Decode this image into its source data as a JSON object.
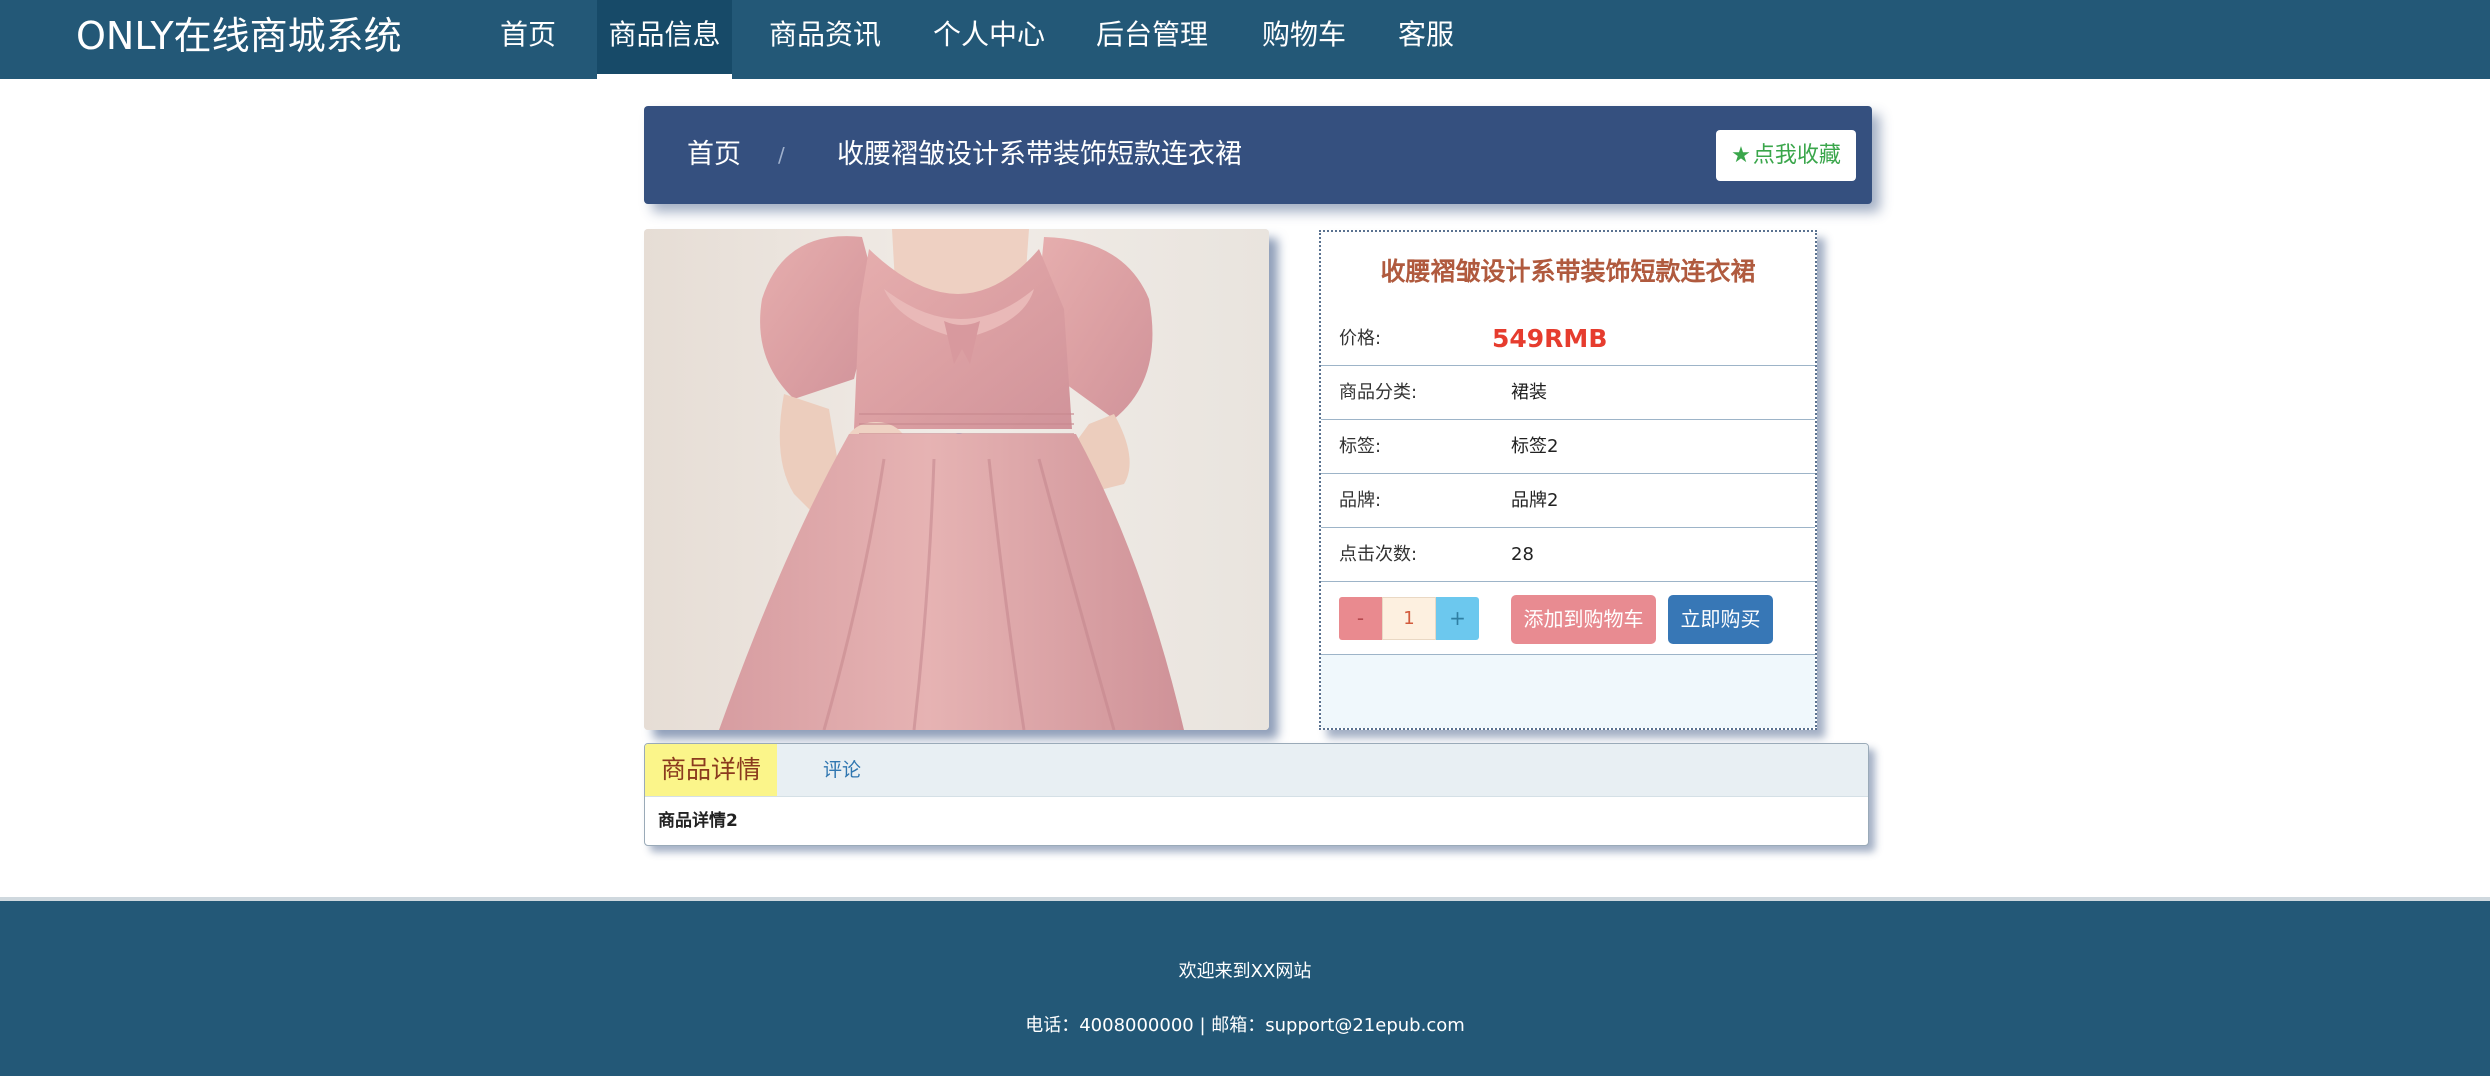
{
  "navbar": {
    "brand": "ONLY在线商城系统",
    "items": [
      {
        "label": "首页"
      },
      {
        "label": "商品信息"
      },
      {
        "label": "商品资讯"
      },
      {
        "label": "个人中心"
      },
      {
        "label": "后台管理"
      },
      {
        "label": "购物车"
      },
      {
        "label": "客服"
      }
    ],
    "active_item": "商品信息"
  },
  "breadcrumb": {
    "home": "首页",
    "separator": "/",
    "current": "收腰褶皱设计系带装饰短款连衣裙"
  },
  "favorite_button": {
    "icon": "star-icon",
    "label": "点我收藏"
  },
  "product": {
    "title": "收腰褶皱设计系带装饰短款连衣裙",
    "price_label": "价格:",
    "price": "549RMB",
    "category_label": "商品分类:",
    "category": "裙装",
    "tag_label": "标签:",
    "tag": "标签2",
    "brand_label": "品牌:",
    "brand": "品牌2",
    "clicks_label": "点击次数:",
    "clicks": "28"
  },
  "quantity": {
    "minus": "-",
    "value": "1",
    "plus": "+"
  },
  "actions": {
    "add_to_cart": "添加到购物车",
    "buy_now": "立即购买"
  },
  "tabs": [
    {
      "label": "商品详情",
      "active": true
    },
    {
      "label": "评论",
      "active": false
    }
  ],
  "tab_content": "商品详情2",
  "footer": {
    "welcome": "欢迎来到XX网站",
    "contact": "电话：4008000000 | 邮箱：support@21epub.com"
  },
  "colors": {
    "navbar": "#235877",
    "breadcrumb_bar": "#35507f",
    "price": "#e63c2e",
    "title": "#b05a3e",
    "add_to_cart": "#e88b91",
    "buy_now": "#3777b6",
    "active_tab": "#fbf58a"
  }
}
